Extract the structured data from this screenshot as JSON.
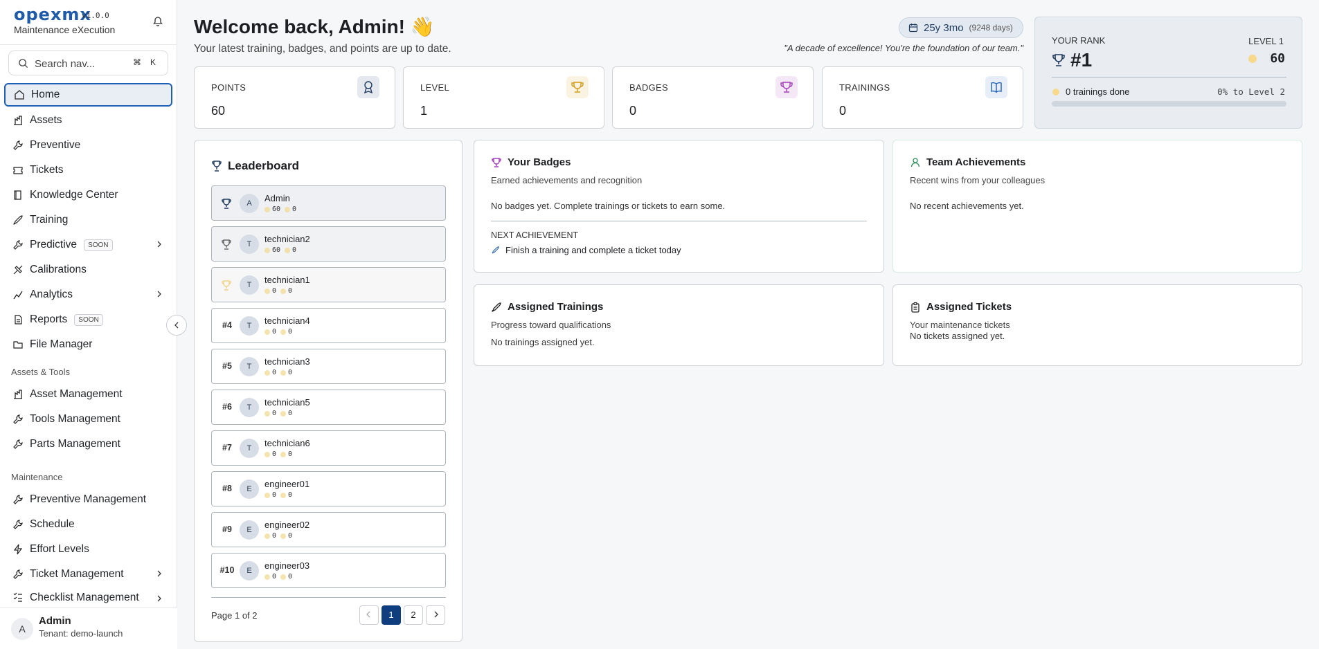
{
  "sidebar": {
    "brand": {
      "logo": "opexmx",
      "version": "v1.0.0",
      "subtitle": "Maintenance eXecution"
    },
    "search": {
      "placeholder": "Search nav...",
      "kbd1": "⌘",
      "kbd2": "K"
    },
    "items": [
      {
        "label": "Home",
        "icon": "home-icon"
      },
      {
        "label": "Assets",
        "icon": "assets-icon"
      },
      {
        "label": "Preventive",
        "icon": "wrench-icon"
      },
      {
        "label": "Tickets",
        "icon": "ticket-icon"
      },
      {
        "label": "Knowledge Center",
        "icon": "book-icon"
      },
      {
        "label": "Training",
        "icon": "rocket-icon"
      },
      {
        "label": "Predictive",
        "icon": "wrench-icon",
        "badge": "SOON"
      },
      {
        "label": "Calibrations",
        "icon": "wrench-icon"
      },
      {
        "label": "Analytics",
        "icon": "wrench-icon"
      },
      {
        "label": "Reports",
        "icon": "file-icon",
        "badge": "SOON"
      },
      {
        "label": "File Manager",
        "icon": "folder-icon"
      }
    ],
    "section_tools": "Assets & Tools",
    "tools_items": [
      {
        "label": "Asset Management"
      },
      {
        "label": "Tools Management"
      },
      {
        "label": "Parts Management"
      }
    ],
    "section_maint": "Maintenance",
    "maint_items": [
      {
        "label": "Preventive Management"
      },
      {
        "label": "Schedule"
      },
      {
        "label": "Effort Levels"
      },
      {
        "label": "Ticket Management"
      },
      {
        "label": "Checklist Management"
      }
    ],
    "user": {
      "initial": "A",
      "name": "Admin",
      "tenant": "Tenant: demo-launch"
    }
  },
  "header": {
    "title": "Welcome back, Admin! 👋",
    "subtitle": "Your latest training, badges, and points are up to date.",
    "tenure": {
      "value": "25y 3mo",
      "days": "(9248 days)"
    },
    "quote": "\"A decade of excellence! You're the foundation of our team.\""
  },
  "stats": [
    {
      "label": "POINTS",
      "value": "60",
      "icon": "award-icon",
      "color": "#e5e8ee"
    },
    {
      "label": "LEVEL",
      "value": "1",
      "icon": "trophy-icon",
      "color": "#fbf3e1"
    },
    {
      "label": "BADGES",
      "value": "0",
      "icon": "trophy-icon",
      "color": "#f4e8f7"
    },
    {
      "label": "TRAININGS",
      "value": "0",
      "icon": "book-icon",
      "color": "#e7eef7"
    }
  ],
  "rank": {
    "label": "YOUR RANK",
    "value": "#1",
    "level_label": "LEVEL 1",
    "level_points": "60",
    "trainings_done": "0 trainings done",
    "progress_text": "0% to Level 2",
    "progress": 0
  },
  "leaderboard": {
    "title": "Leaderboard",
    "rows": [
      {
        "rank": "",
        "initial": "A",
        "name": "Admin",
        "points": "60",
        "badges": "0"
      },
      {
        "rank": "",
        "initial": "T",
        "name": "technician2",
        "points": "60",
        "badges": "0"
      },
      {
        "rank": "",
        "initial": "T",
        "name": "technician1",
        "points": "0",
        "badges": "0"
      },
      {
        "rank": "#4",
        "initial": "T",
        "name": "technician4",
        "points": "0",
        "badges": "0"
      },
      {
        "rank": "#5",
        "initial": "T",
        "name": "technician3",
        "points": "0",
        "badges": "0"
      },
      {
        "rank": "#6",
        "initial": "T",
        "name": "technician5",
        "points": "0",
        "badges": "0"
      },
      {
        "rank": "#7",
        "initial": "T",
        "name": "technician6",
        "points": "0",
        "badges": "0"
      },
      {
        "rank": "#8",
        "initial": "E",
        "name": "engineer01",
        "points": "0",
        "badges": "0"
      },
      {
        "rank": "#9",
        "initial": "E",
        "name": "engineer02",
        "points": "0",
        "badges": "0"
      },
      {
        "rank": "#10",
        "initial": "E",
        "name": "engineer03",
        "points": "0",
        "badges": "0"
      }
    ],
    "page_text": "Page 1 of 2",
    "pages": [
      "1",
      "2"
    ]
  },
  "badges": {
    "title": "Your Badges",
    "subtitle": "Earned achievements and recognition",
    "empty": "No badges yet. Complete trainings or tickets to earn some.",
    "next_label": "NEXT ACHIEVEMENT",
    "next_text": "Finish a training and complete a ticket today"
  },
  "team": {
    "title": "Team Achievements",
    "subtitle": "Recent wins from your colleagues",
    "empty": "No recent achievements yet."
  },
  "trainings": {
    "title": "Assigned Trainings",
    "subtitle": "Progress toward qualifications",
    "empty": "No trainings assigned yet."
  },
  "tickets": {
    "title": "Assigned Tickets",
    "subtitle": "Your maintenance tickets",
    "empty": "No tickets assigned yet."
  }
}
